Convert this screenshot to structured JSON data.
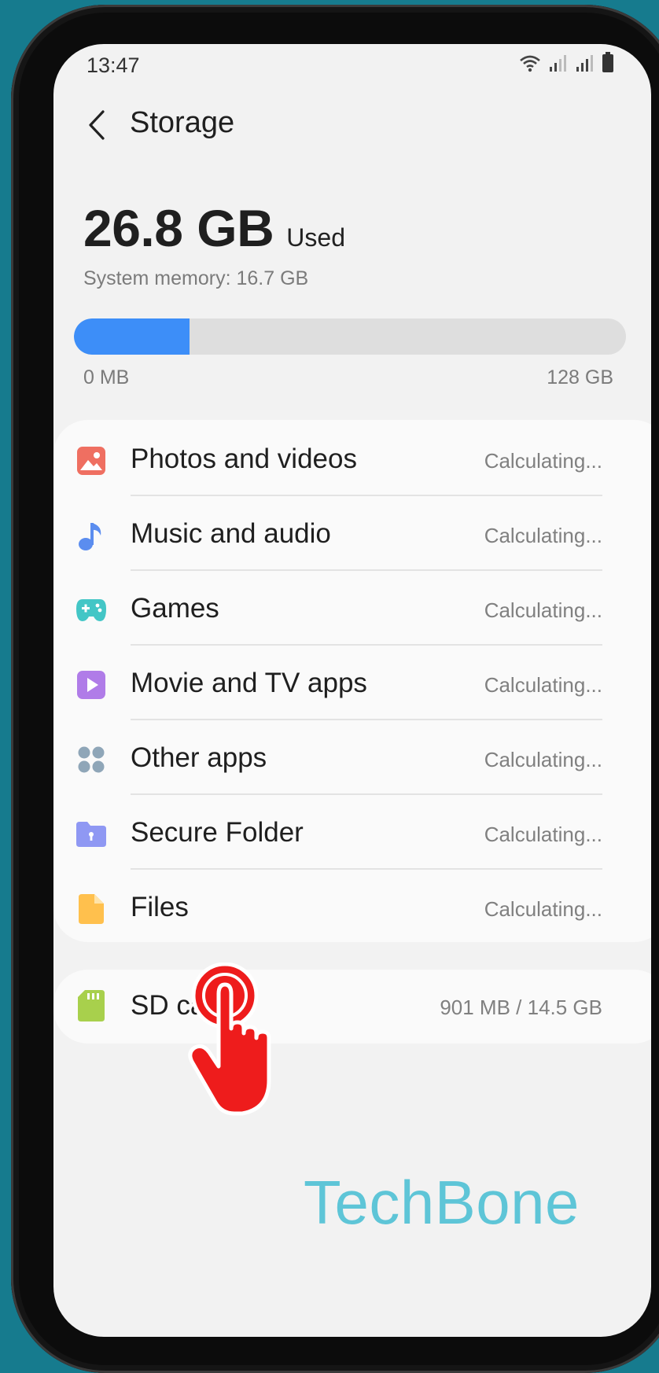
{
  "status_bar": {
    "time": "13:47"
  },
  "header": {
    "title": "Storage"
  },
  "summary": {
    "used_amount": "26.8 GB",
    "used_label": "Used",
    "system_memory": "System memory: 16.7 GB",
    "bar_min_label": "0 MB",
    "bar_max_label": "128 GB",
    "used_fraction": 0.2094
  },
  "categories": [
    {
      "label": "Photos and videos",
      "value": "Calculating...",
      "icon": "photo-icon",
      "color": "#ef6f61"
    },
    {
      "label": "Music and audio",
      "value": "Calculating...",
      "icon": "music-note-icon",
      "color": "#5b8def"
    },
    {
      "label": "Games",
      "value": "Calculating...",
      "icon": "gamepad-icon",
      "color": "#43c6c6"
    },
    {
      "label": "Movie and TV apps",
      "value": "Calculating...",
      "icon": "play-icon",
      "color": "#b07ce8"
    },
    {
      "label": "Other apps",
      "value": "Calculating...",
      "icon": "apps-grid-icon",
      "color": "#8fa6b8"
    },
    {
      "label": "Secure Folder",
      "value": "Calculating...",
      "icon": "secure-folder-icon",
      "color": "#8f98f3"
    },
    {
      "label": "Files",
      "value": "Calculating...",
      "icon": "file-icon",
      "color": "#ffc04d"
    }
  ],
  "sd_card": {
    "label": "SD card",
    "value": "901 MB / 14.5 GB",
    "icon": "sd-card-icon",
    "color": "#a8d04c"
  },
  "watermark": "TechBone",
  "colors": {
    "accent": "#3d8ef8",
    "background": "#167b8e",
    "tap_indicator": "#ee1c1c"
  }
}
